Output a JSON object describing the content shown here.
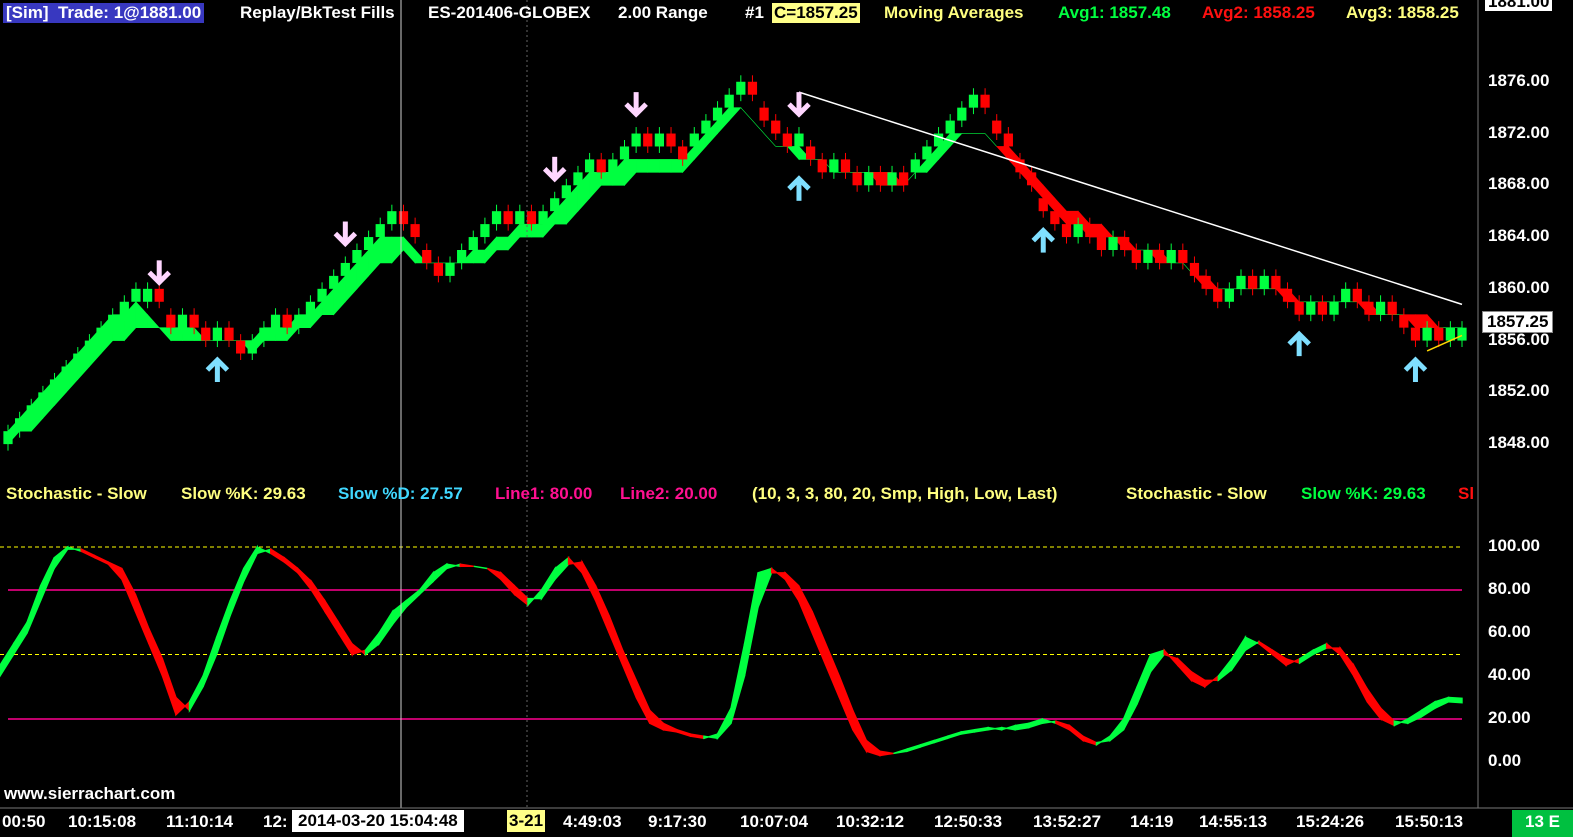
{
  "header": {
    "sim": "[Sim]",
    "trade": "Trade: 1@1881.00",
    "study": "Replay/BkTest Fills",
    "symbol": "ES-201406-GLOBEX",
    "range": "2.00 Range",
    "num": "#1",
    "close": "C=1857.25",
    "ma_label": "Moving Averages",
    "avg1": "Avg1: 1857.48",
    "avg2": "Avg2: 1858.25",
    "avg3": "Avg3: 1858.25",
    "top_price": "1881.00"
  },
  "stoch_header": {
    "name": "Stochastic - Slow",
    "k": "Slow %K: 29.63",
    "d": "Slow %D: 27.57",
    "line1": "Line1: 80.00",
    "line2": "Line2: 20.00",
    "params": "(10, 3, 3, 80, 20, Smp, High, Low, Last)",
    "name2": "Stochastic - Slow",
    "k2": "Slow %K: 29.63",
    "cut": "Sl"
  },
  "footer": {
    "website": "www.sierrachart.com",
    "date_box": "2014-03-20  15:04:48",
    "date_frag": "3-21",
    "corner": "13 E"
  },
  "x_ticks": [
    "00:50",
    "10:15:08",
    "11:10:14",
    "12:",
    "4:49:03",
    "9:17:30",
    "10:07:04",
    "10:32:12",
    "12:50:33",
    "13:52:27",
    "14:19",
    "14:55:13",
    "15:24:26",
    "15:50:13"
  ],
  "colors": {
    "up": "#00ff40",
    "down": "#ff0000",
    "buy_arrow": "#7fdfff",
    "sell_arrow": "#ffd6ff",
    "line1": "#ff0090",
    "dash": "#ffff00"
  },
  "chart_data": [
    {
      "type": "candlestick",
      "title": "ES-201406-GLOBEX 2.00 Range",
      "ylim": [
        1846,
        1880
      ],
      "y_ticks": [
        1876,
        1872,
        1868,
        1864,
        1860,
        1856,
        1852,
        1848
      ],
      "last_price": "1857.25",
      "closes": [
        1849,
        1850,
        1851,
        1852,
        1853,
        1854,
        1855,
        1856,
        1857,
        1858,
        1859,
        1860,
        1860,
        1859,
        1857,
        1858,
        1857,
        1856,
        1857,
        1856,
        1855,
        1856,
        1857,
        1858,
        1857,
        1858,
        1859,
        1860,
        1861,
        1862,
        1863,
        1864,
        1865,
        1866,
        1865,
        1864,
        1862,
        1861,
        1862,
        1863,
        1864,
        1865,
        1866,
        1865,
        1866,
        1865,
        1866,
        1867,
        1868,
        1869,
        1870,
        1869,
        1870,
        1871,
        1872,
        1871,
        1872,
        1871,
        1870,
        1872,
        1873,
        1874,
        1875,
        1876,
        1875,
        1873,
        1872,
        1871,
        1872,
        1870,
        1869,
        1870,
        1869,
        1868,
        1869,
        1868,
        1869,
        1868,
        1870,
        1871,
        1872,
        1873,
        1874,
        1875,
        1874,
        1872,
        1871,
        1869,
        1868,
        1866,
        1865,
        1864,
        1865,
        1864,
        1863,
        1864,
        1863,
        1862,
        1863,
        1862,
        1863,
        1862,
        1861,
        1860,
        1859,
        1860,
        1861,
        1860,
        1861,
        1860,
        1859,
        1858,
        1859,
        1858,
        1859,
        1860,
        1859,
        1858,
        1859,
        1858,
        1857,
        1856,
        1857,
        1856,
        1857,
        1857
      ],
      "ma_fast": [
        1849,
        1850,
        1851,
        1852,
        1853,
        1854,
        1855,
        1856,
        1857,
        1858,
        1858,
        1859,
        1858,
        1857,
        1857,
        1857,
        1857,
        1856,
        1856,
        1856,
        1856,
        1856,
        1857,
        1857,
        1857,
        1858,
        1858,
        1859,
        1860,
        1861,
        1862,
        1863,
        1864,
        1864,
        1864,
        1863,
        1862,
        1862,
        1862,
        1862,
        1863,
        1863,
        1864,
        1864,
        1865,
        1865,
        1865,
        1866,
        1867,
        1868,
        1869,
        1869,
        1869,
        1870,
        1870,
        1870,
        1870,
        1870,
        1870,
        1871,
        1872,
        1873,
        1874,
        1874,
        1873,
        1872,
        1871,
        1871,
        1871,
        1870,
        1870,
        1869,
        1869,
        1869,
        1869,
        1868,
        1868,
        1868,
        1869,
        1870,
        1871,
        1872,
        1872,
        1872,
        1872,
        1871,
        1870,
        1869,
        1868,
        1867,
        1866,
        1865,
        1865,
        1864,
        1864,
        1864,
        1863,
        1863,
        1863,
        1862,
        1862,
        1862,
        1861,
        1860,
        1860,
        1860,
        1860,
        1860,
        1860,
        1860,
        1859,
        1859,
        1859,
        1859,
        1859,
        1859,
        1859,
        1858,
        1858,
        1858,
        1858,
        1857,
        1857,
        1857,
        1857,
        1857
      ],
      "ma_slow": [
        1848,
        1849,
        1849,
        1850,
        1851,
        1852,
        1853,
        1854,
        1855,
        1856,
        1856,
        1857,
        1857,
        1857,
        1856,
        1856,
        1856,
        1856,
        1856,
        1856,
        1856,
        1855,
        1856,
        1856,
        1856,
        1857,
        1857,
        1858,
        1858,
        1859,
        1860,
        1861,
        1862,
        1862,
        1863,
        1862,
        1862,
        1862,
        1862,
        1862,
        1862,
        1862,
        1863,
        1863,
        1864,
        1864,
        1864,
        1865,
        1865,
        1866,
        1867,
        1868,
        1868,
        1868,
        1869,
        1869,
        1869,
        1869,
        1869,
        1870,
        1871,
        1872,
        1873,
        1874,
        1873,
        1872,
        1871,
        1871,
        1870,
        1870,
        1870,
        1869,
        1869,
        1869,
        1869,
        1869,
        1869,
        1868,
        1869,
        1869,
        1870,
        1871,
        1872,
        1872,
        1872,
        1871,
        1871,
        1870,
        1869,
        1868,
        1867,
        1866,
        1866,
        1865,
        1865,
        1864,
        1864,
        1863,
        1863,
        1863,
        1862,
        1862,
        1861,
        1861,
        1860,
        1860,
        1860,
        1860,
        1860,
        1860,
        1860,
        1859,
        1859,
        1859,
        1859,
        1859,
        1859,
        1859,
        1858,
        1858,
        1858,
        1858,
        1858,
        1857,
        1857,
        1857
      ],
      "buy_signals": [
        18,
        68,
        89,
        111,
        121
      ],
      "sell_signals": [
        13,
        29,
        47,
        54,
        68
      ]
    },
    {
      "type": "line",
      "title": "Stochastic - Slow",
      "ylim": [
        -5,
        105
      ],
      "y_ticks": [
        100,
        80,
        60,
        40,
        20,
        0
      ],
      "levels": [
        80,
        20
      ],
      "midlines": [
        100,
        50
      ],
      "k": [
        45,
        55,
        65,
        82,
        95,
        100,
        98,
        95,
        92,
        85,
        70,
        55,
        40,
        22,
        28,
        40,
        58,
        75,
        90,
        100,
        97,
        93,
        88,
        80,
        70,
        60,
        50,
        52,
        60,
        70,
        75,
        80,
        88,
        92,
        91,
        91,
        90,
        85,
        78,
        73,
        80,
        90,
        95,
        88,
        75,
        60,
        45,
        30,
        18,
        15,
        14,
        12,
        11,
        13,
        25,
        55,
        88,
        90,
        85,
        75,
        60,
        45,
        30,
        15,
        5,
        3,
        4,
        6,
        8,
        10,
        12,
        14,
        15,
        16,
        15,
        17,
        18,
        20,
        18,
        15,
        10,
        8,
        12,
        20,
        35,
        50,
        52,
        45,
        38,
        35,
        40,
        48,
        58,
        55,
        50,
        45,
        48,
        52,
        55,
        50,
        40,
        28,
        20,
        17,
        20,
        24,
        28,
        30,
        29.63
      ],
      "d": [
        40,
        50,
        60,
        75,
        90,
        99,
        99,
        96,
        93,
        90,
        78,
        62,
        48,
        30,
        24,
        35,
        50,
        68,
        84,
        97,
        99,
        95,
        90,
        84,
        75,
        65,
        55,
        50,
        55,
        64,
        72,
        78,
        84,
        90,
        92,
        91,
        90,
        88,
        82,
        76,
        76,
        85,
        92,
        93,
        82,
        68,
        52,
        38,
        24,
        18,
        15,
        13,
        12,
        11,
        18,
        40,
        72,
        88,
        88,
        82,
        70,
        55,
        40,
        24,
        10,
        5,
        4,
        5,
        7,
        9,
        11,
        13,
        14,
        15,
        16,
        15,
        16,
        18,
        19,
        17,
        12,
        9,
        10,
        15,
        27,
        42,
        50,
        48,
        42,
        38,
        38,
        43,
        52,
        56,
        52,
        48,
        46,
        50,
        53,
        53,
        45,
        34,
        25,
        19,
        18,
        21,
        25,
        28,
        27.57
      ]
    }
  ]
}
